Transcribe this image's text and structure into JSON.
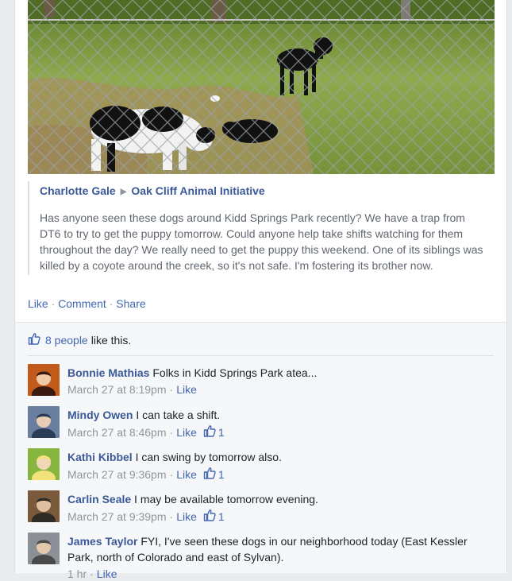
{
  "post": {
    "photo_alt": "Dogs behind a chain-link fence",
    "shared_author": "Charlotte Gale",
    "shared_group": "Oak Cliff Animal Initiative",
    "shared_text": "Has anyone seen these dogs around Kidd Springs Park recently? We have a trap from DT6 to try to get the puppy tomorrow. Could anyone help take shifts watching for them throughout the day? We really need to get the puppy this weekend. One of its siblings was killed by a coyote around the creek, so it's not safe. I'm fostering its brother now."
  },
  "actions": {
    "like": "Like",
    "comment": "Comment",
    "share": "Share",
    "separator": "·"
  },
  "likes": {
    "count_link": "8 people",
    "suffix": "like this."
  },
  "comments": [
    {
      "name": "Bonnie Mathias",
      "text": "Folks in Kidd Springs Park atea...",
      "time": "March 27 at 8:19pm",
      "like": "Like",
      "likes": ""
    },
    {
      "name": "Mindy Owen",
      "text": "I can take a shift.",
      "time": "March 27 at 8:46pm",
      "like": "Like",
      "likes": "1"
    },
    {
      "name": "Kathi Kibbel",
      "text": "I can swing by tomorrow also.",
      "time": "March 27 at 9:36pm",
      "like": "Like",
      "likes": "1"
    },
    {
      "name": "Carlin Seale",
      "text": "I may be available tomorrow evening.",
      "time": "March 27 at 9:39pm",
      "like": "Like",
      "likes": "1"
    },
    {
      "name": "James Taylor",
      "text": "FYI, I've seen these dogs in our neighborhood today (East Kessler Park, north of Colorado and east of Sylvan).",
      "time": "1 hr",
      "like": "Like",
      "likes": ""
    }
  ],
  "icons": {
    "thumbs_up": "thumbs-up-icon",
    "arrow": "triangle-right-icon"
  },
  "colors": {
    "link": "#3b5998",
    "action_link": "#4267b2",
    "meta": "#90949c",
    "ufi_bg": "#f6f7f9"
  }
}
